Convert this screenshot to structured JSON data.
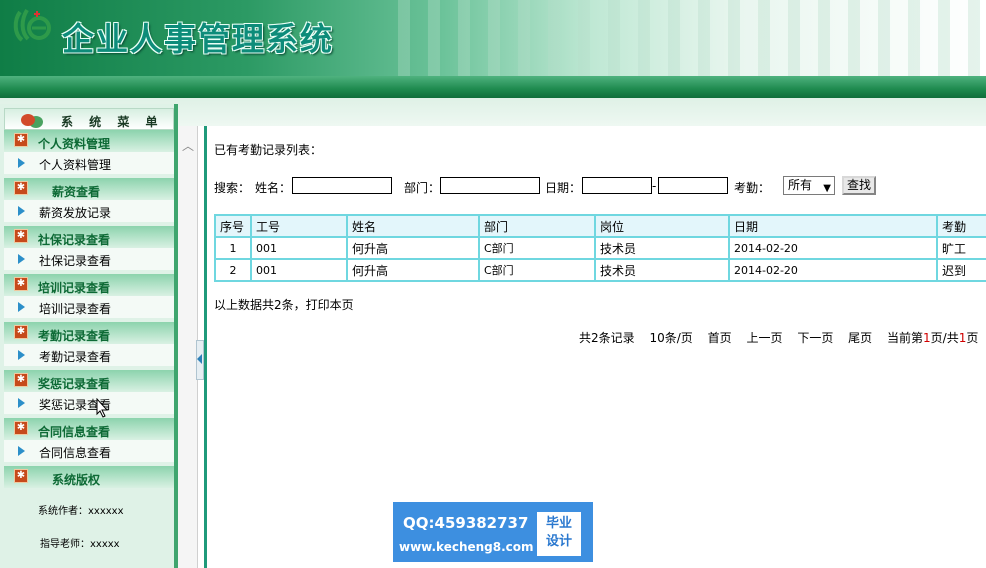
{
  "header": {
    "app_title": "企业人事管理系统"
  },
  "sidebar": {
    "title": "系 统 菜 单",
    "sections": [
      {
        "head": "个人资料管理",
        "item": "个人资料管理"
      },
      {
        "head": "薪资查看",
        "item": "薪资发放记录"
      },
      {
        "head": "社保记录查看",
        "item": "社保记录查看"
      },
      {
        "head": "培训记录查看",
        "item": "培训记录查看"
      },
      {
        "head": "考勤记录查看",
        "item": "考勤记录查看"
      },
      {
        "head": "奖惩记录查看",
        "item": "奖惩记录查看"
      },
      {
        "head": "合同信息查看",
        "item": "合同信息查看"
      }
    ],
    "copyright_head": "系统版权",
    "author": "系统作者：xxxxxx",
    "advisor": "指导老师：xxxxx"
  },
  "main": {
    "list_title": "已有考勤记录列表：",
    "search": {
      "label": "搜索：",
      "name_label": "姓名：",
      "dept_label": "部门：",
      "date_label": "日期：",
      "date_sep": "-",
      "attendance_label": "考勤：",
      "attendance_selected": "所有",
      "button": "查找",
      "name_value": "",
      "dept_value": "",
      "date_from": "",
      "date_to": ""
    },
    "table": {
      "headers": [
        "序号",
        "工号",
        "姓名",
        "部门",
        "岗位",
        "日期",
        "考勤"
      ],
      "rows": [
        [
          "1",
          "001",
          "何升高",
          "C部门",
          "技术员",
          "2014-02-20",
          "旷工"
        ],
        [
          "2",
          "001",
          "何升高",
          "C部门",
          "技术员",
          "2014-02-20",
          "迟到"
        ]
      ]
    },
    "summary": "以上数据共2条，打印本页",
    "pager": {
      "total": "共2条记录",
      "per_page": "10条/页",
      "first": "首页",
      "prev": "上一页",
      "next": "下一页",
      "last": "尾页",
      "current_prefix": "当前第",
      "current_page": "1",
      "current_mid": "页/共",
      "total_pages": "1",
      "current_suffix": "页"
    }
  },
  "watermark": {
    "qq": "QQ:459382737",
    "site": "www.kecheng8.com",
    "badge_line1": "毕业",
    "badge_line2": "设计"
  },
  "colors": {
    "accent_green": "#1e8a4e",
    "title_teal": "#0d8c7a",
    "table_border": "#6fd7e0",
    "pager_red": "#d00000"
  }
}
